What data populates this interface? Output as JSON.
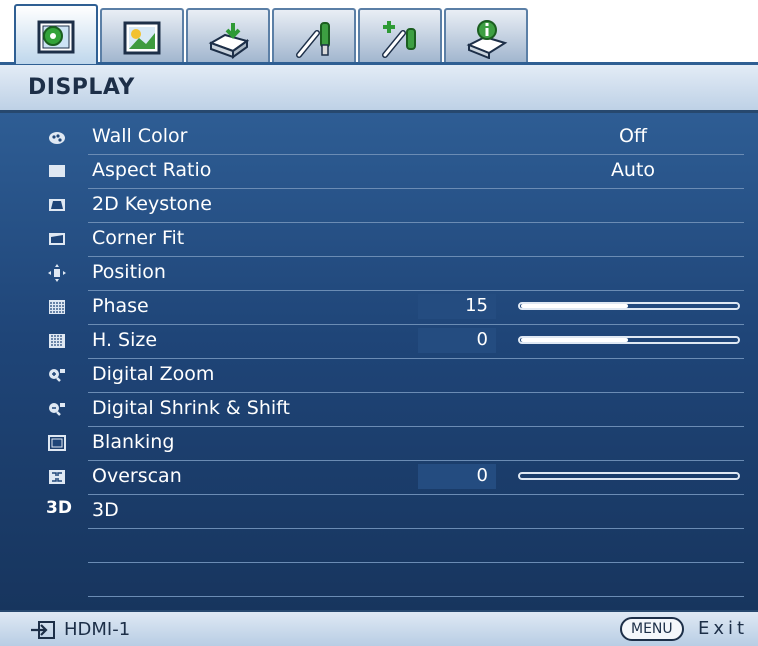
{
  "tabs": [
    {
      "icon": "display-icon",
      "active": true
    },
    {
      "icon": "picture-icon",
      "active": false
    },
    {
      "icon": "source-icon",
      "active": false
    },
    {
      "icon": "system-setup-basic-icon",
      "active": false
    },
    {
      "icon": "system-setup-advanced-icon",
      "active": false
    },
    {
      "icon": "information-icon",
      "active": false
    }
  ],
  "header": {
    "title": "DISPLAY"
  },
  "menu": [
    {
      "label": "Wall Color",
      "value": "Off",
      "icon": "wall-color-icon"
    },
    {
      "label": "Aspect Ratio",
      "value": "Auto",
      "icon": "aspect-ratio-icon"
    },
    {
      "label": "2D Keystone",
      "icon": "keystone-icon"
    },
    {
      "label": "Corner Fit",
      "icon": "corner-fit-icon"
    },
    {
      "label": "Position",
      "icon": "position-icon"
    },
    {
      "label": "Phase",
      "number": "15",
      "level": 0.5,
      "icon": "phase-icon"
    },
    {
      "label": "H. Size",
      "number": "0",
      "level": 0.5,
      "icon": "h-size-icon"
    },
    {
      "label": "Digital Zoom",
      "icon": "digital-zoom-icon"
    },
    {
      "label": "Digital Shrink & Shift",
      "icon": "digital-shrink-icon"
    },
    {
      "label": "Blanking",
      "icon": "blanking-icon"
    },
    {
      "label": "Overscan",
      "number": "0",
      "level": 0.0,
      "icon": "overscan-icon"
    },
    {
      "label": "3D",
      "icon": "3d-icon",
      "icon_text": "3D"
    }
  ],
  "footer": {
    "source": "HDMI-1",
    "menu_button": "MENU",
    "exit_label": "Exit"
  },
  "colors": {
    "panel": "#1f4578",
    "header": "#bed1e6",
    "text": "#ffffff"
  }
}
